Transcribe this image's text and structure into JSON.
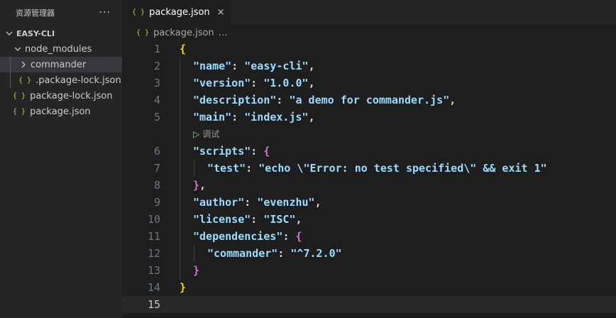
{
  "sidebar": {
    "title": "资源管理器",
    "more": "···",
    "root": "EASY-CLI",
    "items": [
      {
        "label": "node_modules",
        "type": "folder",
        "icon": "chevron-down"
      },
      {
        "label": "commander",
        "type": "folder",
        "icon": "chevron-right"
      },
      {
        "label": ".package-lock.json",
        "type": "json",
        "icon": "{ }"
      },
      {
        "label": "package-lock.json",
        "type": "json",
        "icon": "{ }"
      },
      {
        "label": "package.json",
        "type": "json",
        "icon": "{ }"
      }
    ]
  },
  "tab": {
    "icon": "{ }",
    "label": "package.json",
    "close": "×"
  },
  "breadcrumb": {
    "icon": "{ }",
    "file": "package.json",
    "more": "…"
  },
  "codelens": {
    "label": "调试",
    "icon": "▷"
  },
  "code_lines": [
    {
      "n": "1",
      "t": "{"
    },
    {
      "n": "2",
      "t": "\"name\": \"easy-cli\","
    },
    {
      "n": "3",
      "t": "\"version\": \"1.0.0\","
    },
    {
      "n": "4",
      "t": "\"description\": \"a demo for commander.js\","
    },
    {
      "n": "5",
      "t": "\"main\": \"index.js\","
    },
    {
      "n": "6",
      "t": "\"scripts\": {"
    },
    {
      "n": "7",
      "t": "\"test\": \"echo \\\"Error: no test specified\\\" && exit 1\""
    },
    {
      "n": "8",
      "t": "},"
    },
    {
      "n": "9",
      "t": "\"author\": \"evenzhu\","
    },
    {
      "n": "10",
      "t": "\"license\": \"ISC\","
    },
    {
      "n": "11",
      "t": "\"dependencies\": {"
    },
    {
      "n": "12",
      "t": "\"commander\": \"^7.2.0\""
    },
    {
      "n": "13",
      "t": "}"
    },
    {
      "n": "14",
      "t": "}"
    },
    {
      "n": "15",
      "t": ""
    }
  ],
  "colors": {
    "key": "#9cdcfe",
    "string": "#9cdcfe",
    "brace_level1": "#ffd700",
    "brace_level2": "#da70d6",
    "json_icon": "#cbcb41"
  }
}
